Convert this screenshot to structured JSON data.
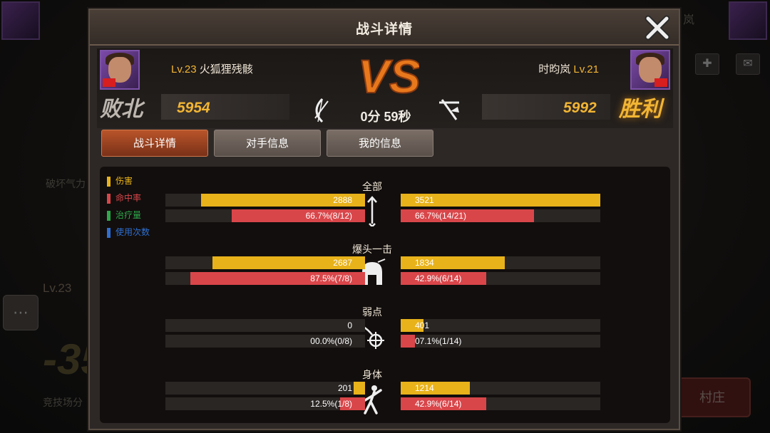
{
  "title": "战斗详情",
  "background": {
    "left_label": "破坏气力",
    "left_level": "Lv.23",
    "left_big": "-35",
    "left_sub": "竞技场分",
    "right_button": "村庄",
    "right_name_fragment": "岚",
    "chat_icon": "chat-bubble-icon"
  },
  "player_left": {
    "level": "Lv.23",
    "name": "火狐狸残骸",
    "result": "败北",
    "score": "5954",
    "weapon_icon": "bow-icon"
  },
  "player_right": {
    "level": "Lv.21",
    "name": "时昀岚",
    "result": "胜利",
    "score": "5992",
    "weapon_icon": "crossbow-icon"
  },
  "vs_label": "VS",
  "duration": "0分 59秒",
  "tabs": [
    {
      "label": "战斗详情",
      "active": true
    },
    {
      "label": "对手信息",
      "active": false
    },
    {
      "label": "我的信息",
      "active": false
    }
  ],
  "legend": [
    {
      "label": "伤害",
      "color": "#e8b21a"
    },
    {
      "label": "命中率",
      "color": "#d9464a"
    },
    {
      "label": "治疗量",
      "color": "#2ea84a"
    },
    {
      "label": "使用次数",
      "color": "#2f6fd1"
    }
  ],
  "colors": {
    "damage": "#e8b21a",
    "accuracy": "#d9464a",
    "result_lose": "#bdb7b0",
    "result_win": "#f2b533"
  },
  "sections": [
    {
      "title": "全部",
      "icon": "arrow-icon",
      "damage": {
        "left": "2888",
        "right": "3521",
        "left_value": 2888,
        "right_value": 3521
      },
      "accuracy": {
        "left": "66.7%(8/12)",
        "right": "66.7%(14/21)",
        "left_value": 0.667,
        "right_value": 0.667
      }
    },
    {
      "title": "爆头一击",
      "icon": "helmet-icon",
      "damage": {
        "left": "2687",
        "right": "1834",
        "left_value": 2687,
        "right_value": 1834
      },
      "accuracy": {
        "left": "87.5%(7/8)",
        "right": "42.9%(6/14)",
        "left_value": 0.875,
        "right_value": 0.429
      }
    },
    {
      "title": "弱点",
      "icon": "weakpoint-target-icon",
      "damage": {
        "left": "0",
        "right": "401",
        "left_value": 0,
        "right_value": 401
      },
      "accuracy": {
        "left": "00.0%(0/8)",
        "right": "07.1%(1/14)",
        "left_value": 0.0,
        "right_value": 0.071
      }
    },
    {
      "title": "身体",
      "icon": "body-figure-icon",
      "damage": {
        "left": "201",
        "right": "1214",
        "left_value": 201,
        "right_value": 1214
      },
      "accuracy": {
        "left": "12.5%(1/8)",
        "right": "42.9%(6/14)",
        "left_value": 0.125,
        "right_value": 0.429
      }
    }
  ],
  "damage_scale_max": 3521
}
